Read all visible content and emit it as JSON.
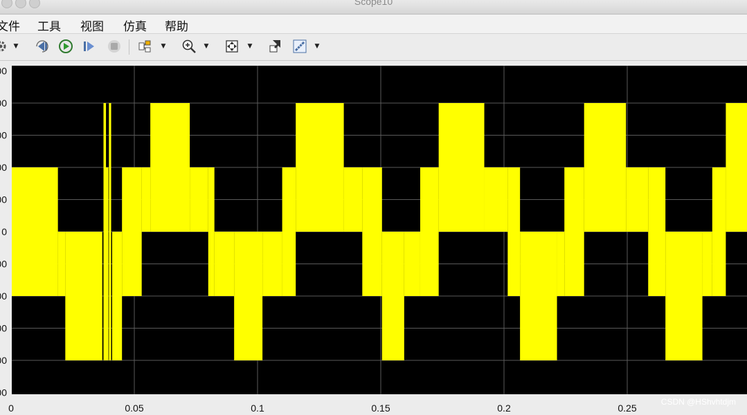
{
  "window": {
    "title": "Scope10"
  },
  "menu": [
    {
      "id": "file",
      "label": "文件"
    },
    {
      "id": "tools",
      "label": "工具"
    },
    {
      "id": "view",
      "label": "视图"
    },
    {
      "id": "simulation",
      "label": "仿真"
    },
    {
      "id": "help",
      "label": "帮助"
    }
  ],
  "toolbar": [
    "settings-icon",
    "step-back-icon",
    "run-icon",
    "step-forward-icon",
    "stop-icon",
    "signal-selector-icon",
    "zoom-in-icon",
    "fit-to-view-icon",
    "highlight-block-icon",
    "measurements-icon"
  ],
  "watermark": "CSDN @HShvhtdjm",
  "colors": {
    "plot_bg": "#000000",
    "trace": "#ffff00",
    "grid": "#5a5a5a",
    "axis_text": "#111111"
  },
  "chart_data": {
    "type": "line",
    "title": "",
    "xlabel": "",
    "ylabel": "",
    "grid": true,
    "xlim": [
      0,
      0.3
    ],
    "x_ticks": [
      "0",
      "0.05",
      "0.1",
      "0.15",
      "0.2",
      "0.25"
    ],
    "x_tick_values": [
      0,
      0.05,
      0.1,
      0.15,
      0.2,
      0.25
    ],
    "y_ticks": [
      "00",
      "00",
      "00",
      "00",
      "00",
      "0",
      "00",
      "00",
      "00",
      "00",
      "00"
    ],
    "ylim": [
      -5.2,
      5.2
    ],
    "y_levels": [
      -4,
      -3,
      -2,
      -1,
      0,
      1,
      2,
      3,
      4
    ],
    "series": [
      {
        "color": "#ffff00",
        "segments": [
          {
            "x0": 0.0,
            "x1": 0.019,
            "ymin": -2,
            "ymax": 2
          },
          {
            "x0": 0.019,
            "x1": 0.022,
            "ymin": -2,
            "ymax": 0
          },
          {
            "x0": 0.022,
            "x1": 0.037,
            "ymin": -4,
            "ymax": 0
          },
          {
            "x0": 0.0375,
            "x1": 0.0385,
            "ymin": -4,
            "ymax": 4
          },
          {
            "x0": 0.0385,
            "x1": 0.0395,
            "ymin": -4,
            "ymax": 2
          },
          {
            "x0": 0.0397,
            "x1": 0.0406,
            "ymin": -4,
            "ymax": 4
          },
          {
            "x0": 0.041,
            "x1": 0.045,
            "ymin": -4,
            "ymax": 0
          },
          {
            "x0": 0.045,
            "x1": 0.053,
            "ymin": -2,
            "ymax": 2
          },
          {
            "x0": 0.053,
            "x1": 0.0565,
            "ymin": 0,
            "ymax": 2
          },
          {
            "x0": 0.0565,
            "x1": 0.0725,
            "ymin": 0,
            "ymax": 4
          },
          {
            "x0": 0.0725,
            "x1": 0.08,
            "ymin": 0,
            "ymax": 2
          },
          {
            "x0": 0.08,
            "x1": 0.0825,
            "ymin": -2,
            "ymax": 2
          },
          {
            "x0": 0.0825,
            "x1": 0.0905,
            "ymin": -2,
            "ymax": 0
          },
          {
            "x0": 0.0905,
            "x1": 0.102,
            "ymin": -4,
            "ymax": 0
          },
          {
            "x0": 0.102,
            "x1": 0.11,
            "ymin": -2,
            "ymax": 0
          },
          {
            "x0": 0.11,
            "x1": 0.1155,
            "ymin": -2,
            "ymax": 2
          },
          {
            "x0": 0.1155,
            "x1": 0.135,
            "ymin": 0,
            "ymax": 4
          },
          {
            "x0": 0.135,
            "x1": 0.1425,
            "ymin": 0,
            "ymax": 2
          },
          {
            "x0": 0.1425,
            "x1": 0.1505,
            "ymin": -2,
            "ymax": 2
          },
          {
            "x0": 0.1505,
            "x1": 0.1595,
            "ymin": -4,
            "ymax": 0
          },
          {
            "x0": 0.1595,
            "x1": 0.166,
            "ymin": -2,
            "ymax": 0
          },
          {
            "x0": 0.166,
            "x1": 0.1735,
            "ymin": -2,
            "ymax": 2
          },
          {
            "x0": 0.1735,
            "x1": 0.192,
            "ymin": 0,
            "ymax": 4
          },
          {
            "x0": 0.192,
            "x1": 0.2015,
            "ymin": 0,
            "ymax": 2
          },
          {
            "x0": 0.2015,
            "x1": 0.2065,
            "ymin": -2,
            "ymax": 2
          },
          {
            "x0": 0.2065,
            "x1": 0.2215,
            "ymin": -4,
            "ymax": 0
          },
          {
            "x0": 0.2215,
            "x1": 0.2245,
            "ymin": -2,
            "ymax": 0
          },
          {
            "x0": 0.2245,
            "x1": 0.2325,
            "ymin": -2,
            "ymax": 2
          },
          {
            "x0": 0.2325,
            "x1": 0.2495,
            "ymin": 0,
            "ymax": 4
          },
          {
            "x0": 0.2495,
            "x1": 0.2585,
            "ymin": 0,
            "ymax": 2
          },
          {
            "x0": 0.2585,
            "x1": 0.2655,
            "ymin": -2,
            "ymax": 2
          },
          {
            "x0": 0.2655,
            "x1": 0.2805,
            "ymin": -4,
            "ymax": 0
          },
          {
            "x0": 0.2805,
            "x1": 0.2845,
            "ymin": -2,
            "ymax": 0
          },
          {
            "x0": 0.2845,
            "x1": 0.29,
            "ymin": -2,
            "ymax": 2
          },
          {
            "x0": 0.29,
            "x1": 0.3,
            "ymin": 0,
            "ymax": 4
          }
        ]
      }
    ]
  }
}
